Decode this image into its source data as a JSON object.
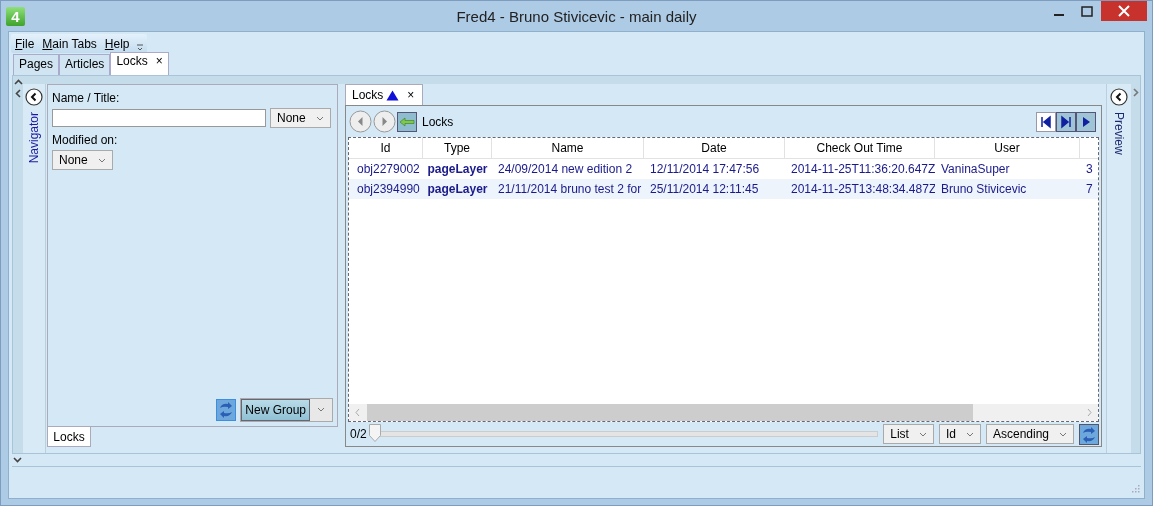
{
  "window": {
    "app_badge": "4",
    "title": "Fred4 - Bruno Stivicevic - main daily"
  },
  "menu": [
    "File",
    "Main Tabs",
    "Help"
  ],
  "tabs": [
    {
      "label": "Pages",
      "selected": false
    },
    {
      "label": "Articles",
      "selected": false
    },
    {
      "label": "Locks",
      "selected": true,
      "close": "×"
    }
  ],
  "navigator": {
    "title": "Navigator",
    "name_label": "Name / Title:",
    "name_filter": "None",
    "modified_label": "Modified on:",
    "modified_filter": "None",
    "new_group": "New Group",
    "bottom_tab": "Locks"
  },
  "document": {
    "tab": "Locks",
    "tab_close": "×",
    "toolbar_label": "Locks",
    "table": {
      "columns": [
        "Id",
        "Type",
        "Name",
        "Date",
        "Check Out Time",
        "User"
      ],
      "rows": [
        {
          "selected": false,
          "cells": [
            "obj2279002",
            "pageLayer",
            "24/09/2014 new edition 2",
            "12/11/2014 17:47:56",
            "2014-11-25T11:36:20.647Z",
            "VaninaSuper",
            "3"
          ]
        },
        {
          "selected": true,
          "cells": [
            "obj2394990",
            "pageLayer",
            "21/11/2014 bruno test 2 for",
            "25/11/2014 12:11:45",
            "2014-11-25T13:48:34.487Z",
            "Bruno Stivicevic",
            "7"
          ]
        }
      ]
    },
    "counter": "0/2",
    "slider": {
      "level": 0
    },
    "view": "List",
    "sort_field": "Id",
    "sort_order": "Ascending"
  },
  "preview": {
    "title": "Preview"
  }
}
